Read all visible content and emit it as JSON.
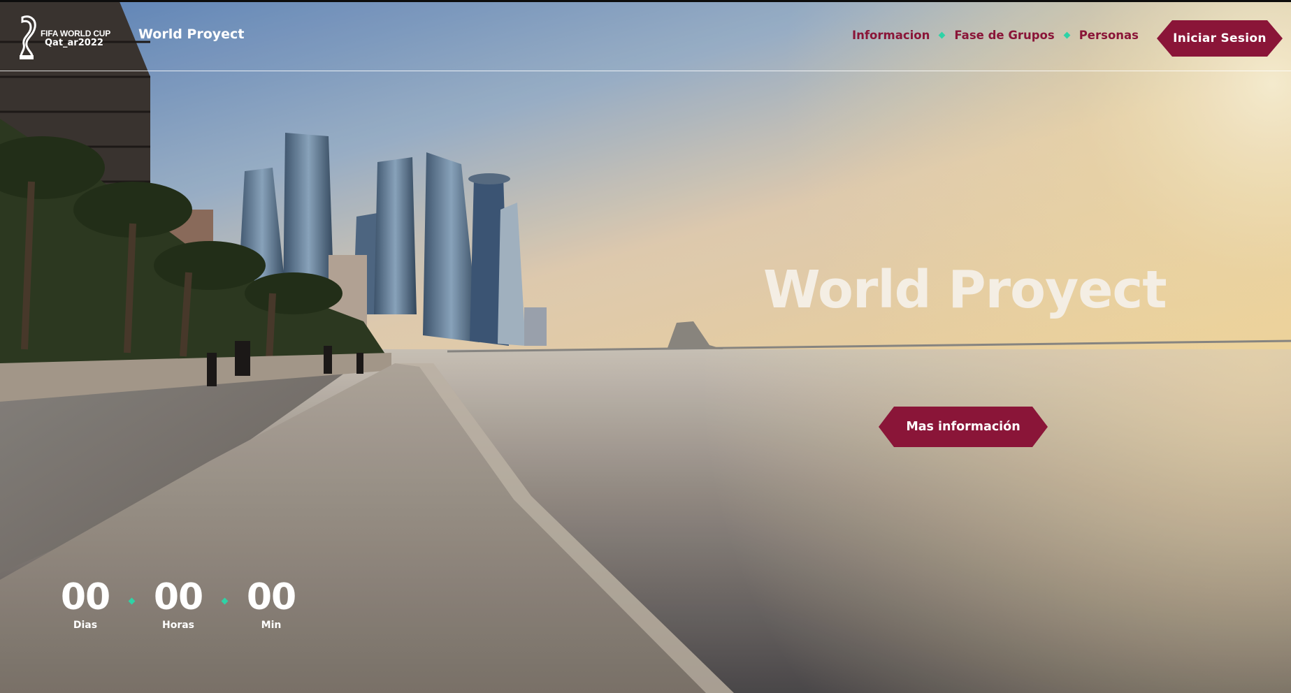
{
  "header": {
    "logo": {
      "line1": "FIFA WORLD CUP",
      "line2": "Qat_ar2022",
      "icon": "trophy-icon"
    },
    "brand": "World Proyect",
    "nav": [
      {
        "label": "Informacion"
      },
      {
        "label": "Fase de Grupos"
      },
      {
        "label": "Personas"
      }
    ],
    "login_label": "Iniciar Sesion"
  },
  "hero": {
    "title": "World Proyect",
    "cta_label": "Mas información"
  },
  "countdown": {
    "days": "00",
    "days_label": "Dias",
    "hours": "00",
    "hours_label": "Horas",
    "minutes": "00",
    "minutes_label": "Min"
  },
  "colors": {
    "accent": "#8a1538",
    "separator": "#2ed3a6",
    "title": "#f4eee4"
  }
}
